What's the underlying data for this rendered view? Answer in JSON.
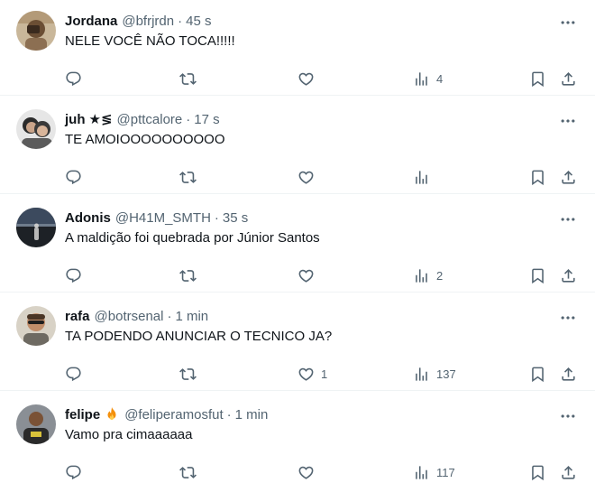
{
  "tweets": [
    {
      "name": "Jordana",
      "handle": "@bfrjrdn",
      "time": "45 s",
      "text": "NELE VOCÊ NÃO TOCA!!!!!",
      "replies": "",
      "retweets": "",
      "likes": "",
      "views": "4"
    },
    {
      "name": "juh",
      "name_icons": "★≶",
      "handle": "@pttcalore",
      "time": "17 s",
      "text": "TE AMOIOOOOOOOOOO",
      "replies": "",
      "retweets": "",
      "likes": "",
      "views": ""
    },
    {
      "name": "Adonis",
      "handle": "@H41M_SMTH",
      "time": "35 s",
      "text": "A maldição foi quebrada por Júnior Santos",
      "replies": "",
      "retweets": "",
      "likes": "",
      "views": "2"
    },
    {
      "name": "rafa",
      "handle": "@botrsenal",
      "time": "1 min",
      "text": "TA PODENDO ANUNCIAR O TECNICO JA?",
      "replies": "",
      "retweets": "",
      "likes": "1",
      "views": "137"
    },
    {
      "name": "felipe",
      "name_emoji": "fire-emoji",
      "handle": "@feliperamosfut",
      "time": "1 min",
      "text": "Vamo pra cimaaaaaa",
      "replies": "",
      "retweets": "",
      "likes": "",
      "views": "117"
    }
  ],
  "separator": "·",
  "colors": {
    "text": "#0f1419",
    "secondary": "#536471",
    "divider": "#eff3f4"
  },
  "icons": [
    "reply-icon",
    "retweet-icon",
    "like-icon",
    "views-icon",
    "bookmark-icon",
    "share-icon",
    "more-icon"
  ]
}
